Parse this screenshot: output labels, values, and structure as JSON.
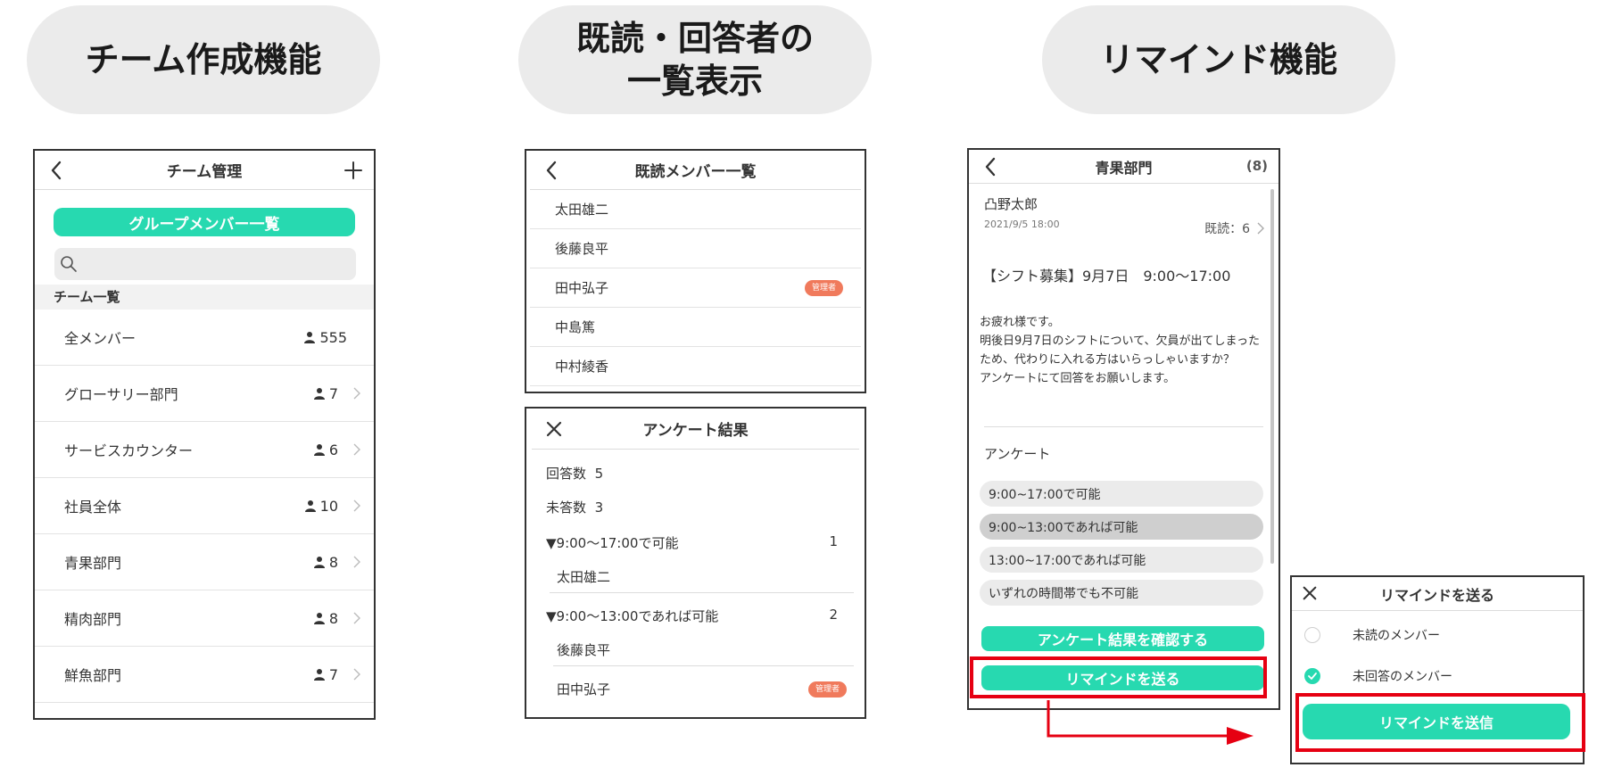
{
  "headings": {
    "team": "チーム作成機能",
    "read": "既読・回答者の\n一覧表示",
    "remind": "リマインド機能"
  },
  "team_panel": {
    "title": "チーム管理",
    "group_button": "グループメンバー一覧",
    "search_placeholder": "",
    "section_label": "チーム一覧",
    "teams": [
      {
        "name": "全メンバー",
        "count": "555"
      },
      {
        "name": "グローサリー部門",
        "count": "7"
      },
      {
        "name": "サービスカウンター",
        "count": "6"
      },
      {
        "name": "社員全体",
        "count": "10"
      },
      {
        "name": "青果部門",
        "count": "8"
      },
      {
        "name": "精肉部門",
        "count": "8"
      },
      {
        "name": "鮮魚部門",
        "count": "7"
      }
    ]
  },
  "read_panel": {
    "title": "既読メンバー一覧",
    "admin_badge": "管理者",
    "members": [
      {
        "name": "太田雄二",
        "admin": false
      },
      {
        "name": "後藤良平",
        "admin": false
      },
      {
        "name": "田中弘子",
        "admin": true
      },
      {
        "name": "中島篤",
        "admin": false
      },
      {
        "name": "中村綾香",
        "admin": false
      }
    ]
  },
  "survey_panel": {
    "title": "アンケート結果",
    "answered_label": "回答数",
    "answered_count": "5",
    "unanswered_label": "未答数",
    "unanswered_count": "3",
    "groups": [
      {
        "option": "▼9:00〜17:00で可能",
        "count": "1",
        "members": [
          "太田雄二"
        ]
      },
      {
        "option": "▼9:00〜13:00であれば可能",
        "count": "2",
        "members": [
          "後藤良平",
          "田中弘子"
        ]
      }
    ],
    "admin_badge": "管理者"
  },
  "post_panel": {
    "title": "青果部門",
    "member_count": "(8)",
    "author": "凸野太郎",
    "date": "2021/9/5 18:00",
    "read_status": "既読：6",
    "subject": "【シフト募集】9月7日　9:00〜17:00",
    "body": "お疲れ様です。\n明後日9月7日のシフトについて、欠員が出てしまったため、代わりに入れる方はいらっしゃいますか？\nアンケートにて回答をお願いします。",
    "survey_label": "アンケート",
    "options": [
      {
        "label": "9:00~17:00で可能",
        "selected": false
      },
      {
        "label": "9:00~13:00であれば可能",
        "selected": true
      },
      {
        "label": "13:00~17:00であれば可能",
        "selected": false
      },
      {
        "label": "いずれの時間帯でも不可能",
        "selected": false
      }
    ],
    "confirm_button": "アンケート結果を確認する",
    "remind_button": "リマインドを送る"
  },
  "remind_panel": {
    "title": "リマインドを送る",
    "options": [
      {
        "label": "未読のメンバー",
        "checked": false
      },
      {
        "label": "未回答のメンバー",
        "checked": true
      }
    ],
    "send_button": "リマインドを送信"
  },
  "colors": {
    "accent": "#27d9b0",
    "badge": "#f07a5c",
    "highlight": "#e60012",
    "pill": "#ebebeb"
  }
}
